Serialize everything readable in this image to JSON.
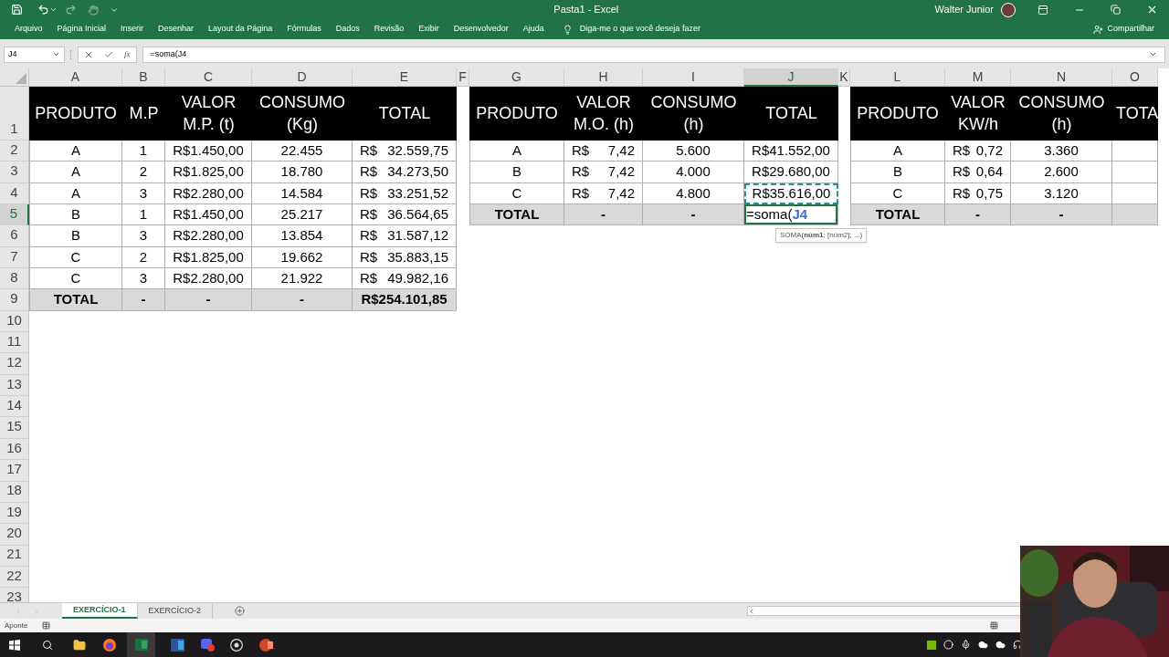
{
  "title_bar": {
    "title": "Pasta1 - Excel",
    "user": "Walter Junior"
  },
  "ribbon_tabs": [
    "Arquivo",
    "Página Inicial",
    "Inserir",
    "Desenhar",
    "Layout da Página",
    "Fórmulas",
    "Dados",
    "Revisão",
    "Exibir",
    "Desenvolvedor",
    "Ajuda"
  ],
  "tell_me": "Diga-me o que você deseja fazer",
  "share": "Compartilhar",
  "formula_bar": {
    "name_box": "J4",
    "function_label": "fx",
    "formula": "=soma(J4"
  },
  "column_headers": [
    {
      "label": "A",
      "selected": false
    },
    {
      "label": "B",
      "selected": false
    },
    {
      "label": "C",
      "selected": false
    },
    {
      "label": "D",
      "selected": false
    },
    {
      "label": "E",
      "selected": false
    },
    {
      "label": "F",
      "selected": false
    },
    {
      "label": "G",
      "selected": false
    },
    {
      "label": "H",
      "selected": false
    },
    {
      "label": "I",
      "selected": false
    },
    {
      "label": "J",
      "selected": true
    },
    {
      "label": "K",
      "selected": false
    },
    {
      "label": "L",
      "selected": false
    },
    {
      "label": "M",
      "selected": false
    },
    {
      "label": "N",
      "selected": false
    },
    {
      "label": "O",
      "selected": false
    }
  ],
  "row_headers": [
    {
      "label": "1",
      "selected": false
    },
    {
      "label": "2",
      "selected": false
    },
    {
      "label": "3",
      "selected": false
    },
    {
      "label": "4",
      "selected": false
    },
    {
      "label": "5",
      "selected": true
    },
    {
      "label": "6",
      "selected": false
    },
    {
      "label": "7",
      "selected": false
    },
    {
      "label": "8",
      "selected": false
    },
    {
      "label": "9",
      "selected": false
    },
    {
      "label": "10",
      "selected": false
    },
    {
      "label": "11",
      "selected": false
    },
    {
      "label": "12",
      "selected": false
    },
    {
      "label": "13",
      "selected": false
    },
    {
      "label": "14",
      "selected": false
    },
    {
      "label": "15",
      "selected": false
    },
    {
      "label": "16",
      "selected": false
    },
    {
      "label": "17",
      "selected": false
    },
    {
      "label": "18",
      "selected": false
    },
    {
      "label": "19",
      "selected": false
    },
    {
      "label": "20",
      "selected": false
    },
    {
      "label": "21",
      "selected": false
    },
    {
      "label": "22",
      "selected": false
    },
    {
      "label": "23",
      "selected": false
    }
  ],
  "tables": [
    {
      "header": [
        "PRODUTO",
        "M.P",
        "VALOR M.P. (t)",
        "CONSUMO (Kg)",
        "TOTAL"
      ],
      "rows": [
        [
          "A",
          "1",
          "R$1.450,00",
          "22.455",
          {
            "currency": "R$",
            "amount": "32.559,75"
          }
        ],
        [
          "A",
          "2",
          "R$1.825,00",
          "18.780",
          {
            "currency": "R$",
            "amount": "34.273,50"
          }
        ],
        [
          "A",
          "3",
          "R$2.280,00",
          "14.584",
          {
            "currency": "R$",
            "amount": "33.251,52"
          }
        ],
        [
          "B",
          "1",
          "R$1.450,00",
          "25.217",
          {
            "currency": "R$",
            "amount": "36.564,65"
          }
        ],
        [
          "B",
          "3",
          "R$2.280,00",
          "13.854",
          {
            "currency": "R$",
            "amount": "31.587,12"
          }
        ],
        [
          "C",
          "2",
          "R$1.825,00",
          "19.662",
          {
            "currency": "R$",
            "amount": "35.883,15"
          }
        ],
        [
          "C",
          "3",
          "R$2.280,00",
          "21.922",
          {
            "currency": "R$",
            "amount": "49.982,16"
          }
        ]
      ],
      "total": [
        "TOTAL",
        "-",
        "-",
        "-",
        "R$254.101,85"
      ]
    },
    {
      "header": [
        "PRODUTO",
        "VALOR M.O. (h)",
        "CONSUMO (h)",
        "TOTAL"
      ],
      "rows": [
        [
          "A",
          {
            "currency": "R$",
            "amount": "7,42"
          },
          "5.600",
          "R$41.552,00"
        ],
        [
          "B",
          {
            "currency": "R$",
            "amount": "7,42"
          },
          "4.000",
          "R$29.680,00"
        ],
        [
          "C",
          {
            "currency": "R$",
            "amount": "7,42"
          },
          "4.800",
          {
            "text": "R$35.616,00",
            "referenced": true
          }
        ]
      ],
      "total": [
        "TOTAL",
        "-",
        "-",
        {
          "kind": "editing",
          "text": "=soma(",
          "reference": "J4"
        }
      ]
    },
    {
      "header": [
        "PRODUTO",
        "VALOR KW/h",
        "CONSUMO (h)",
        "TOTA"
      ],
      "rows": [
        [
          "A",
          {
            "currency": "R$",
            "amount": "0,72"
          },
          "3.360"
        ],
        [
          "B",
          {
            "currency": "R$",
            "amount": "0,64"
          },
          "2.600"
        ],
        [
          "C",
          {
            "currency": "R$",
            "amount": "0,75"
          },
          "3.120"
        ]
      ],
      "total": [
        "TOTAL",
        "-",
        "-"
      ]
    }
  ],
  "tooltip": "SOMA(**núm1**; [núm2]; ...)",
  "sheet_tabs": [
    {
      "label": "EXERCÍCIO-1",
      "selected": true
    },
    {
      "label": "EXERCÍCIO-2",
      "selected": false
    }
  ],
  "status_bar": {
    "mode": "Aponte"
  }
}
